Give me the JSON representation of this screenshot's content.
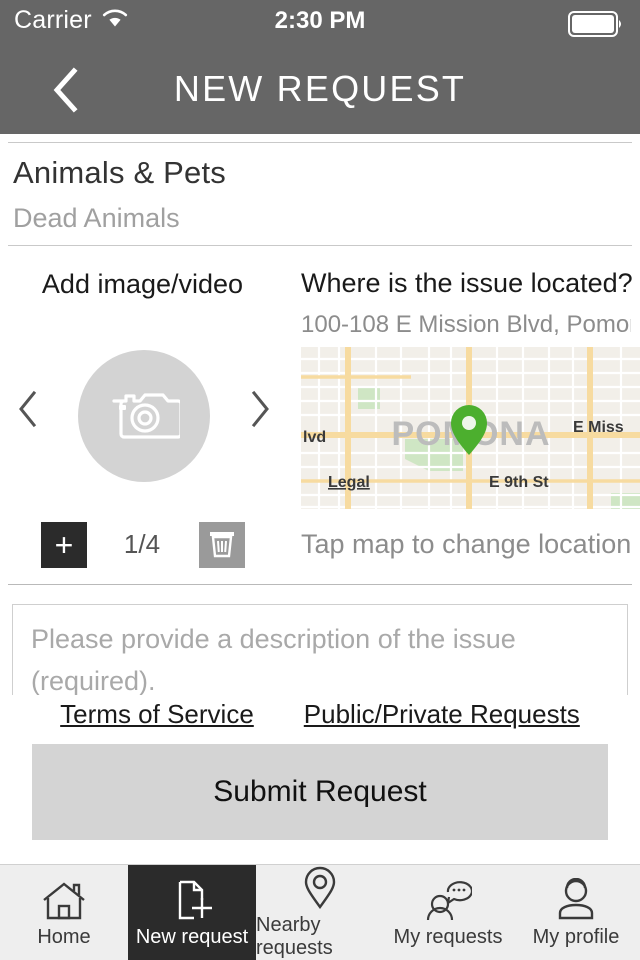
{
  "statusbar": {
    "carrier": "Carrier",
    "time": "2:30 PM",
    "wifi_icon": "wifi-icon",
    "battery_icon": "battery-full-icon"
  },
  "header": {
    "title": "NEW REQUEST",
    "back_icon": "chevron-left-icon"
  },
  "category": {
    "main": "Animals & Pets",
    "sub": "Dead Animals"
  },
  "media": {
    "label": "Add image/video",
    "camera_icon": "camera-icon",
    "prev_icon": "chevron-left-icon",
    "next_icon": "chevron-right-icon",
    "add_label": "+",
    "counter": "1/4",
    "trash_icon": "trash-icon"
  },
  "location": {
    "title": "Where is the issue located?",
    "address": "100-108 E Mission Blvd, Pomon…",
    "hint": "Tap map to change location",
    "pin_icon": "map-pin-icon",
    "map_labels": {
      "city": "POMONA",
      "west": "lvd",
      "east": "E Miss",
      "south_west": "Legal",
      "south": "E 9th St"
    },
    "colors": {
      "map_background": "#f2efe9",
      "arterial_road": "#f7dba0",
      "minor_road": "#ffffff",
      "park": "#cfe6c4",
      "pin": "#4caf2e"
    }
  },
  "description": {
    "placeholder": "Please provide a description of the issue (required).",
    "value": ""
  },
  "links": {
    "terms": "Terms of Service",
    "privacy": "Public/Private Requests"
  },
  "submit": {
    "label": "Submit Request"
  },
  "tabbar": {
    "items": [
      {
        "label": "Home",
        "icon": "home-icon",
        "active": false
      },
      {
        "label": "New request",
        "icon": "document-plus-icon",
        "active": true
      },
      {
        "label": "Nearby requests",
        "icon": "map-pin-icon",
        "active": false
      },
      {
        "label": "My requests",
        "icon": "person-chat-icon",
        "active": false
      },
      {
        "label": "My profile",
        "icon": "person-icon",
        "active": false
      }
    ]
  }
}
